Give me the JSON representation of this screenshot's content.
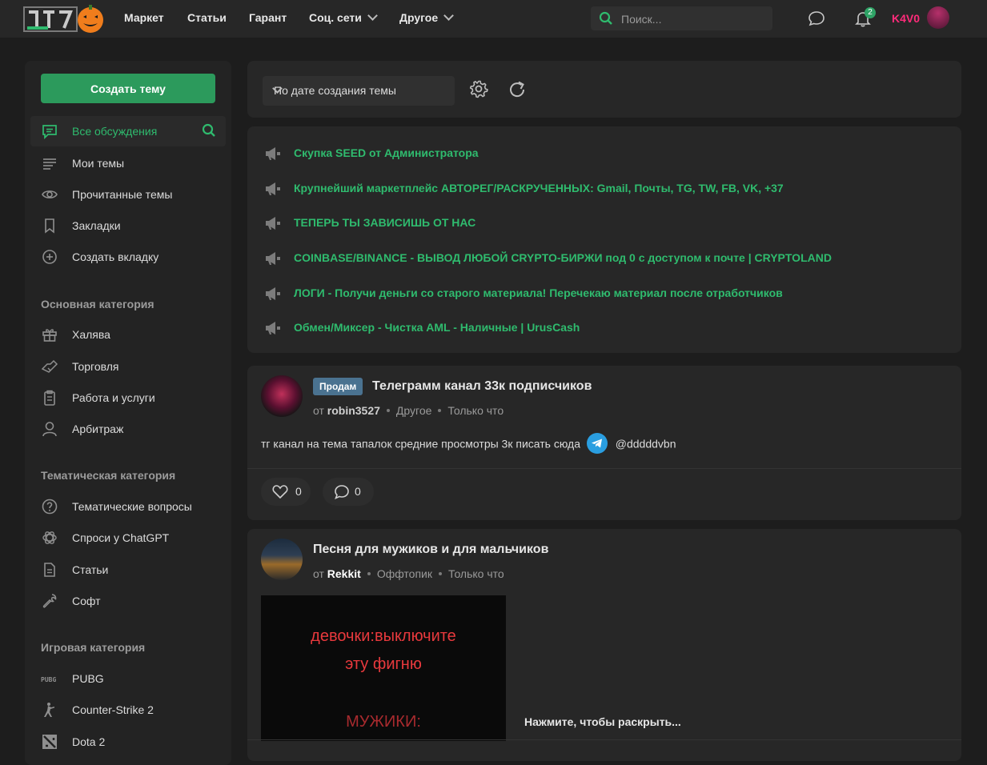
{
  "colors": {
    "accent": "#2fbb6e",
    "brand_button": "#2c9a5c",
    "username": "#ff2b7a",
    "prefix": "#4a7290"
  },
  "header": {
    "nav": [
      "Маркет",
      "Статьи",
      "Гарант",
      "Соц. сети",
      "Другое"
    ],
    "search_placeholder": "Поиск...",
    "notifications_count": "2",
    "username": "K4V0"
  },
  "sidebar": {
    "create_label": "Создать тему",
    "items": [
      {
        "label": "Все обсуждения",
        "icon": "chat-icon"
      },
      {
        "label": "Мои темы",
        "icon": "list-icon"
      },
      {
        "label": "Прочитанные темы",
        "icon": "eye-icon"
      },
      {
        "label": "Закладки",
        "icon": "bookmark-icon"
      },
      {
        "label": "Создать вкладку",
        "icon": "plus-circle-icon"
      }
    ],
    "sections": [
      {
        "title": "Основная категория",
        "items": [
          {
            "label": "Халява",
            "icon": "gift-icon"
          },
          {
            "label": "Торговля",
            "icon": "handshake-icon"
          },
          {
            "label": "Работа и услуги",
            "icon": "clipboard-icon"
          },
          {
            "label": "Арбитраж",
            "icon": "user-icon"
          }
        ]
      },
      {
        "title": "Тематическая категория",
        "items": [
          {
            "label": "Тематические вопросы",
            "icon": "question-icon"
          },
          {
            "label": "Спроси у ChatGPT",
            "icon": "openai-icon"
          },
          {
            "label": "Статьи",
            "icon": "document-icon"
          },
          {
            "label": "Софт",
            "icon": "wrench-icon"
          }
        ]
      },
      {
        "title": "Игровая категория",
        "items": [
          {
            "label": "PUBG",
            "icon": "pubg-icon",
            "icon_text": "PUBG"
          },
          {
            "label": "Counter-Strike 2",
            "icon": "cs2-icon"
          },
          {
            "label": "Dota 2",
            "icon": "dota-icon"
          }
        ]
      }
    ]
  },
  "toolbar": {
    "sort_label": "По дате создания темы"
  },
  "announcements": [
    "Скупка SEED от Администратора",
    "Крупнейший маркетплейс АВТОРЕГ/РАСКРУЧЕННЫХ: Gmail, Почты, TG, TW, FB, VK, +37",
    "ТЕПЕРЬ ТЫ ЗАВИСИШЬ ОТ НАС",
    "COINBASE/BINANCE - ВЫВОД ЛЮБОЙ CRYPTO-БИРЖИ под 0 с доступом к почте | CRYPTOLAND",
    "ЛОГИ - Получи деньги со старого материала! Перечекаю материал после отработчиков",
    "Обмен/Миксер - Чистка AML - Наличные | UrusCash"
  ],
  "threads": [
    {
      "prefix": "Продам",
      "title": "Телеграмм канал 33к подписчиков",
      "by": "от",
      "author": "robin3527",
      "category": "Другое",
      "time": "Только что",
      "preview": "тг канал на тема тапалок средние просмотры 3к писать сюда",
      "handle": "@dddddvbn",
      "likes": "0",
      "comments": "0"
    },
    {
      "title": "Песня для мужиков и для мальчиков",
      "by": "от",
      "author": "Rekkit",
      "category": "Оффтопик",
      "time": "Только что",
      "media_lines": [
        "девочки:выключите",
        "эту фигню",
        "МУЖИКИ:"
      ],
      "expand_label": "Нажмите, чтобы раскрыть..."
    }
  ]
}
